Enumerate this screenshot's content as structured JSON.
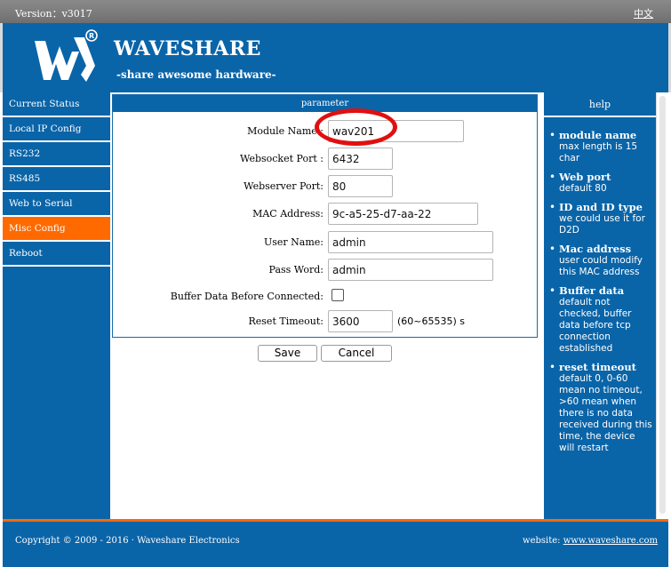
{
  "topbar": {
    "version": "Version：v3017",
    "lang": "中文"
  },
  "header": {
    "brand": "WAVESHARE",
    "tagline": "-share awesome hardware-"
  },
  "nav": [
    {
      "label": "Current Status",
      "active": false
    },
    {
      "label": "Local IP Config",
      "active": false
    },
    {
      "label": "RS232",
      "active": false
    },
    {
      "label": "RS485",
      "active": false
    },
    {
      "label": "Web to Serial",
      "active": false
    },
    {
      "label": "Misc Config",
      "active": true
    },
    {
      "label": "Reboot",
      "active": false
    }
  ],
  "panel": {
    "title": "parameter",
    "fields": {
      "module_name": {
        "label": "Module Name :",
        "value": "wav201"
      },
      "websocket_port": {
        "label": "Websocket Port :",
        "value": "6432"
      },
      "webserver_port": {
        "label": "Webserver Port:",
        "value": "80"
      },
      "mac": {
        "label": "MAC Address:",
        "value": "9c-a5-25-d7-aa-22"
      },
      "user_name": {
        "label": "User Name:",
        "value": "admin"
      },
      "pass_word": {
        "label": "Pass Word:",
        "value": "admin"
      },
      "buffer": {
        "label": "Buffer Data Before Connected:",
        "checked": false
      },
      "reset_timeout": {
        "label": "Reset Timeout:",
        "value": "3600",
        "hint": "(60~65535)  s"
      }
    }
  },
  "buttons": {
    "save": "Save",
    "cancel": "Cancel"
  },
  "help": {
    "title": "help",
    "items": [
      {
        "title": "module name",
        "text": "max length is 15 char"
      },
      {
        "title": "Web port",
        "text": "default 80"
      },
      {
        "title": "ID and ID type",
        "text": "we could use it for D2D"
      },
      {
        "title": "Mac address",
        "text": "user could modify this MAC address"
      },
      {
        "title": "Buffer data",
        "text": "default not checked, buffer data before tcp connection established"
      },
      {
        "title": "reset timeout",
        "text": "default 0, 0-60 mean no timeout, >60 mean when there is no data received during this time, the device will restart"
      }
    ]
  },
  "footer": {
    "copyright": "Copyright © 2009 - 2016 · Waveshare Electronics",
    "website_label": "website: ",
    "website_link": "www.waveshare.com"
  },
  "colors": {
    "primary": "#0a64a8",
    "accent": "#ff6a00",
    "highlight_ring": "#e01010"
  }
}
